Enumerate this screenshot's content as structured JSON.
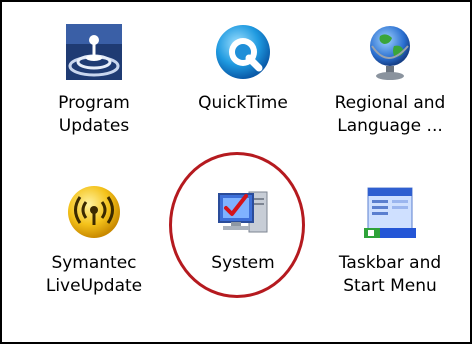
{
  "items": [
    {
      "label": "Program\nUpdates",
      "icon": "program-updates-icon"
    },
    {
      "label": "QuickTime",
      "icon": "quicktime-icon"
    },
    {
      "label": "Regional and\nLanguage ...",
      "icon": "globe-icon"
    },
    {
      "label": "Symantec\nLiveUpdate",
      "icon": "symantec-liveupdate-icon"
    },
    {
      "label": "System",
      "icon": "system-computer-icon"
    },
    {
      "label": "Taskbar and\nStart Menu",
      "icon": "taskbar-start-menu-icon"
    }
  ],
  "colors": {
    "highlight_ring": "#b51a1f",
    "frame_border": "#000000",
    "background": "#ffffff"
  }
}
